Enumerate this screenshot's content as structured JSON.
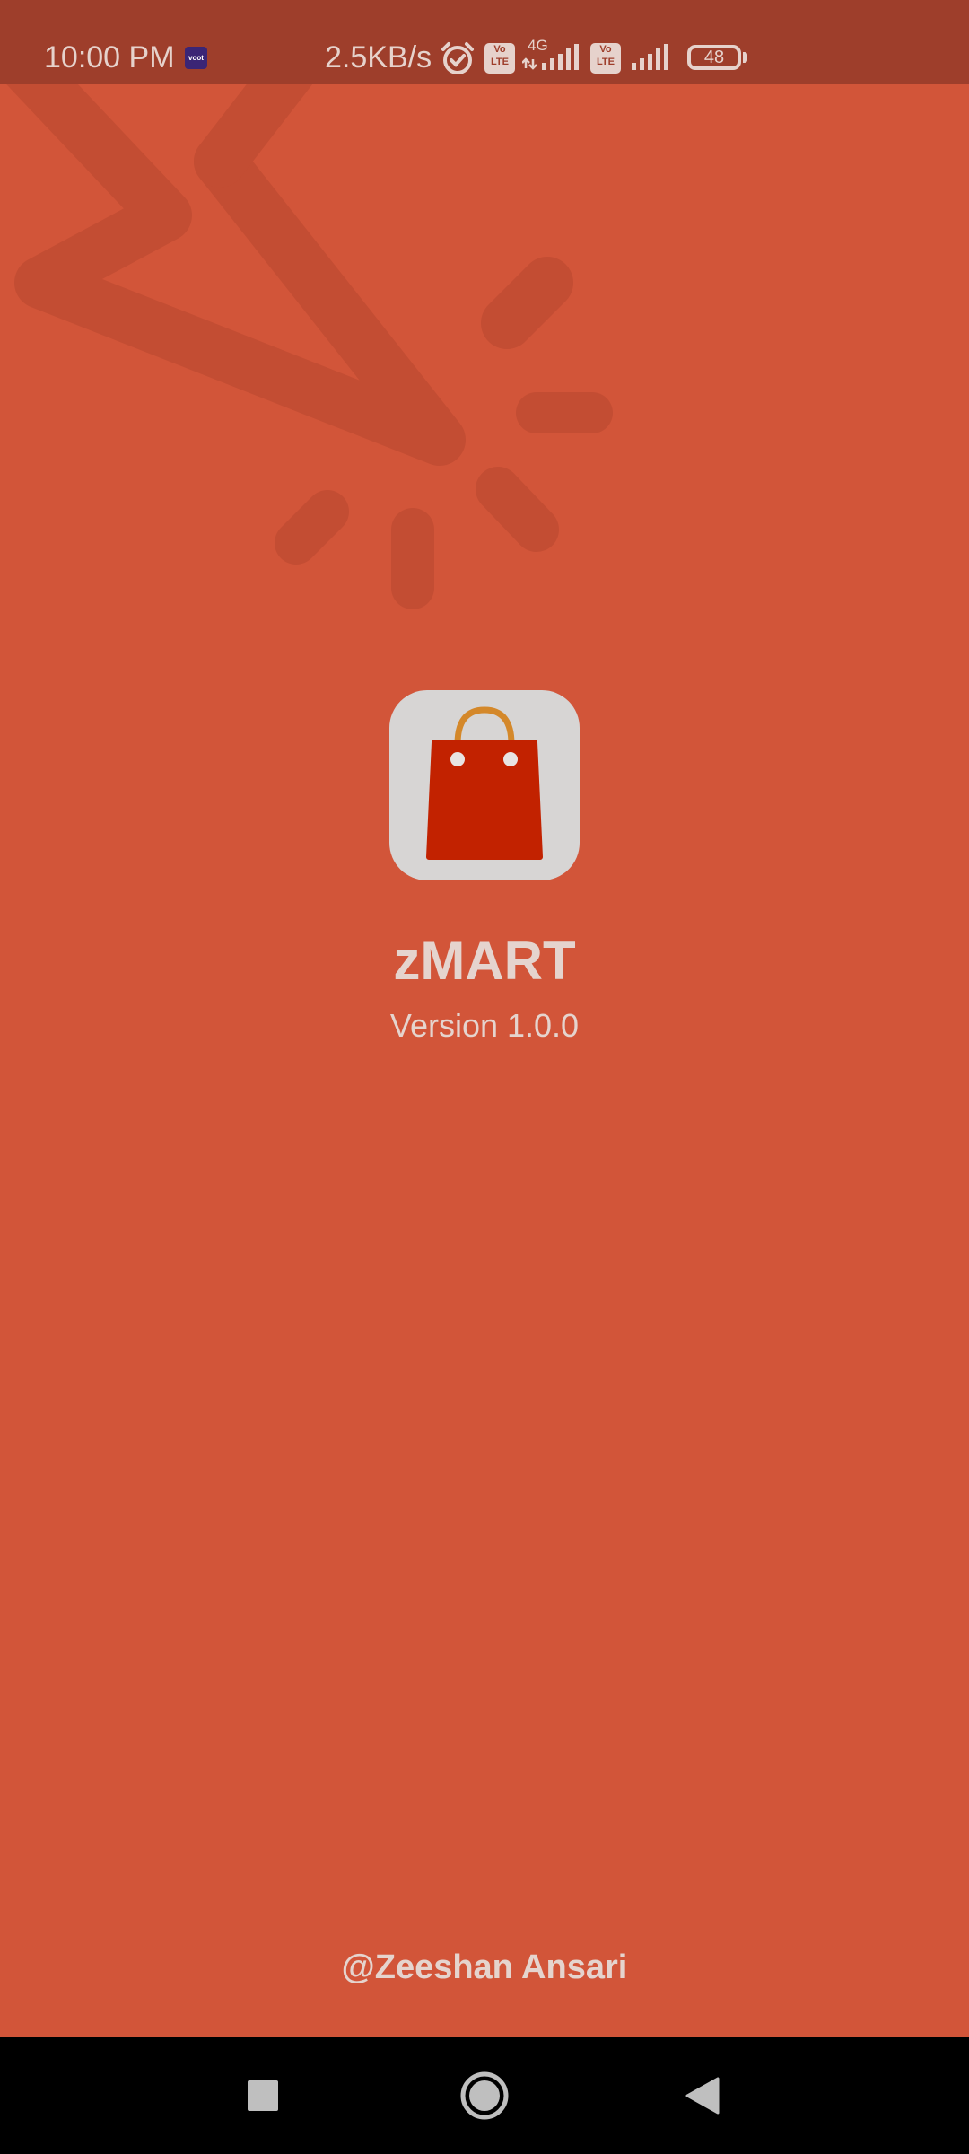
{
  "status_bar": {
    "time": "10:00 PM",
    "notification_app": "voot",
    "net_speed": "2.5KB/s",
    "lte_badge_1": "Vo LTE",
    "network_type": "4G",
    "lte_badge_2": "Vo LTE",
    "battery_level": "48",
    "icons": [
      "alarm-icon",
      "volte-icon",
      "signal-4g-icon",
      "volte-icon",
      "signal-icon",
      "battery-icon"
    ]
  },
  "splash": {
    "app_name": "zMART",
    "version": "Version 1.0.0",
    "author": "@Zeeshan Ansari",
    "logo_icon": "shopping-bag-icon"
  },
  "nav_bar": {
    "recents_icon": "recents-square-icon",
    "home_icon": "home-circle-icon",
    "back_icon": "back-triangle-icon"
  },
  "colors": {
    "background": "#D25539",
    "status_bar": "#9E3E2B",
    "logo_tile": "#D7D5D4",
    "bag": "#C22200",
    "bag_handle": "#D4882A",
    "text": "#E5D4CE",
    "nav_bar": "#000000"
  }
}
